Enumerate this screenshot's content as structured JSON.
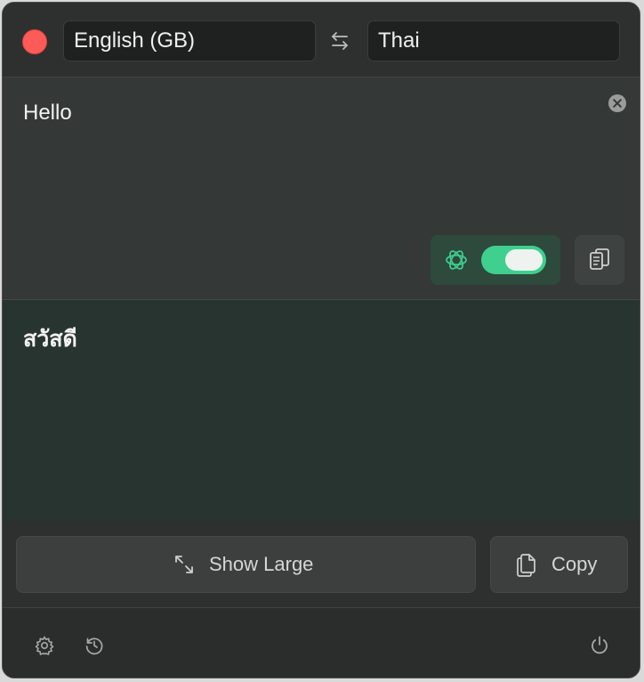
{
  "header": {
    "source_language": "English (GB)",
    "target_language": "Thai",
    "swap_icon": "swap-arrows-icon",
    "close_icon": "close-window-icon"
  },
  "input": {
    "text": "Hello",
    "clear_icon": "clear-icon",
    "ai_icon": "ai-sparkle-icon",
    "ai_toggle_on": true,
    "paste_icon": "paste-icon"
  },
  "output": {
    "text": "สวัสดี"
  },
  "actions": {
    "show_large_label": "Show Large",
    "show_large_icon": "expand-arrows-icon",
    "copy_label": "Copy",
    "copy_icon": "copy-icon"
  },
  "footer": {
    "settings_icon": "gear-icon",
    "history_icon": "history-icon",
    "power_icon": "power-icon"
  },
  "colors": {
    "close": "#fc5b57",
    "accent_green": "#3fcf8e",
    "window_bg": "#2b2d2d",
    "input_bg": "#343836",
    "output_bg": "#283430"
  }
}
